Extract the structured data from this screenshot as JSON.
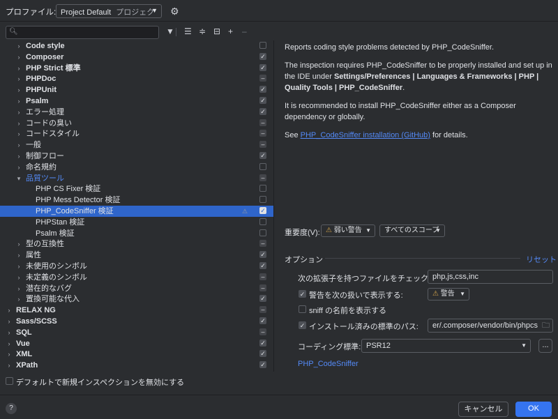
{
  "profile": {
    "label": "プロファイル:",
    "value": "Project Default",
    "value_suffix": "プロジェク"
  },
  "tree": [
    {
      "label": "Code style",
      "indent": 1,
      "arrow": "›",
      "bold": true,
      "check": "empty"
    },
    {
      "label": "Composer",
      "indent": 1,
      "arrow": "›",
      "bold": true,
      "check": "on"
    },
    {
      "label": "PHP Strict 標準",
      "indent": 1,
      "arrow": "›",
      "bold": true,
      "check": "on"
    },
    {
      "label": "PHPDoc",
      "indent": 1,
      "arrow": "›",
      "bold": true,
      "check": "mixed"
    },
    {
      "label": "PHPUnit",
      "indent": 1,
      "arrow": "›",
      "bold": true,
      "check": "on"
    },
    {
      "label": "Psalm",
      "indent": 1,
      "arrow": "›",
      "bold": true,
      "check": "on"
    },
    {
      "label": "エラー処理",
      "indent": 1,
      "arrow": "›",
      "check": "on"
    },
    {
      "label": "コードの臭い",
      "indent": 1,
      "arrow": "›",
      "check": "mixed"
    },
    {
      "label": "コードスタイル",
      "indent": 1,
      "arrow": "›",
      "check": "mixed"
    },
    {
      "label": "一般",
      "indent": 1,
      "arrow": "›",
      "check": "mixed"
    },
    {
      "label": "制御フロー",
      "indent": 1,
      "arrow": "›",
      "check": "on"
    },
    {
      "label": "命名規約",
      "indent": 1,
      "arrow": "›",
      "check": "empty"
    },
    {
      "label": "品質ツール",
      "indent": 1,
      "arrow": "⌄",
      "blue": true,
      "check": "mixed"
    },
    {
      "label": "PHP CS Fixer 検証",
      "indent": 2,
      "arrow": "",
      "check": "empty"
    },
    {
      "label": "PHP Mess Detector 検証",
      "indent": 2,
      "arrow": "",
      "check": "empty"
    },
    {
      "label": "PHP_CodeSniffer 検証",
      "indent": 2,
      "arrow": "",
      "check": "on",
      "selected": true,
      "warn": true
    },
    {
      "label": "PHPStan 検証",
      "indent": 2,
      "arrow": "",
      "check": "empty"
    },
    {
      "label": "Psalm 検証",
      "indent": 2,
      "arrow": "",
      "check": "empty"
    },
    {
      "label": "型の互換性",
      "indent": 1,
      "arrow": "›",
      "check": "mixed"
    },
    {
      "label": "属性",
      "indent": 1,
      "arrow": "›",
      "check": "on"
    },
    {
      "label": "未使用のシンボル",
      "indent": 1,
      "arrow": "›",
      "check": "on"
    },
    {
      "label": "未定義のシンボル",
      "indent": 1,
      "arrow": "›",
      "check": "mixed"
    },
    {
      "label": "潜在的なバグ",
      "indent": 1,
      "arrow": "›",
      "check": "mixed"
    },
    {
      "label": "置換可能な代入",
      "indent": 1,
      "arrow": "›",
      "check": "on"
    },
    {
      "label": "RELAX NG",
      "indent": 0,
      "arrow": "›",
      "bold": true,
      "check": "mixed"
    },
    {
      "label": "Sass/SCSS",
      "indent": 0,
      "arrow": "›",
      "bold": true,
      "check": "on"
    },
    {
      "label": "SQL",
      "indent": 0,
      "arrow": "›",
      "bold": true,
      "check": "mixed"
    },
    {
      "label": "Vue",
      "indent": 0,
      "arrow": "›",
      "bold": true,
      "check": "on"
    },
    {
      "label": "XML",
      "indent": 0,
      "arrow": "›",
      "bold": true,
      "check": "on"
    },
    {
      "label": "XPath",
      "indent": 0,
      "arrow": "›",
      "bold": true,
      "check": "on"
    }
  ],
  "disable_new_label": "デフォルトで新規インスペクションを無効にする",
  "description": {
    "p1": "Reports coding style problems detected by PHP_CodeSniffer.",
    "p2_a": "The inspection requires PHP_CodeSniffer to be properly installed and set up in the IDE under ",
    "p2_b": "Settings/Preferences | Languages & Frameworks | PHP | Quality Tools | PHP_CodeSniffer",
    "p2_c": ".",
    "p3": "It is recommended to install PHP_CodeSniffer either as a Composer dependency or globally.",
    "p4_a": "See ",
    "p4_link": "PHP_CodeSniffer installation (GitHub)",
    "p4_b": " for details."
  },
  "severity": {
    "label": "重要度(V):",
    "value": "弱い警告",
    "scope": "すべてのスコープ"
  },
  "options": {
    "title": "オプション",
    "reset": "リセット",
    "ext_label": "次の拡張子を持つファイルをチェック:",
    "ext_value": "php,js,css,inc",
    "show_warn_label": "警告を次の扱いで表示する:",
    "show_warn_value": "警告",
    "sniff_label": "sniff の名前を表示する",
    "installed_label": "インストール済みの標準のパス:",
    "installed_value": "er/.composer/vendor/bin/phpcs",
    "coding_label": "コーディング標準:",
    "coding_value": "PSR12",
    "more": "...",
    "link": "PHP_CodeSniffer"
  },
  "buttons": {
    "help": "?",
    "cancel": "キャンセル",
    "ok": "OK"
  },
  "colors": {
    "background": "#2b2d30",
    "selection": "#2f65ca",
    "link": "#548af7",
    "warning": "#d3a44a"
  }
}
